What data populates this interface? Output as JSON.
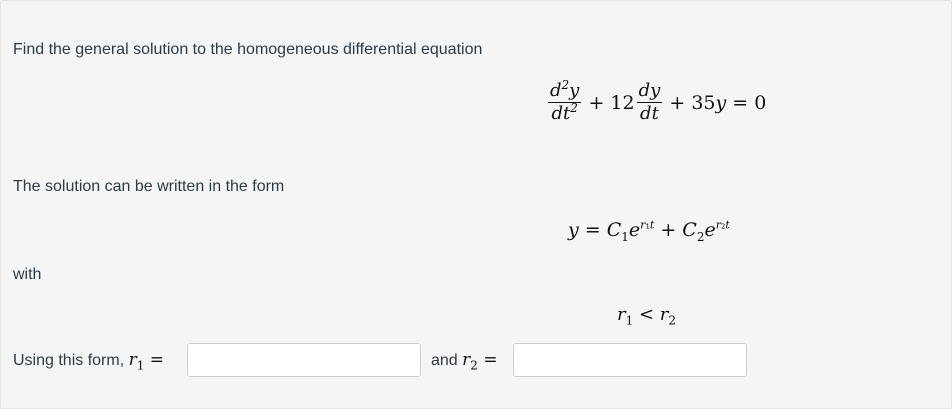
{
  "problem": {
    "intro": "Find the general solution to the homogeneous differential equation",
    "equation": {
      "d2y": "d²y",
      "dt2_num_d": "d",
      "dt2_den": "dt",
      "term2_coef": "+ 12",
      "dy": "dy",
      "dt": "dt",
      "term3": "+ 35y = 0"
    },
    "form_text": "The solution can be written in the form",
    "solution_form": "y = C1e^(r1 t) + C2e^(r2 t)",
    "with_text": "with",
    "condition": "r1 < r2",
    "answer_prefix": "Using this form,",
    "and_text": "and",
    "r1_value": "",
    "r2_value": ""
  }
}
